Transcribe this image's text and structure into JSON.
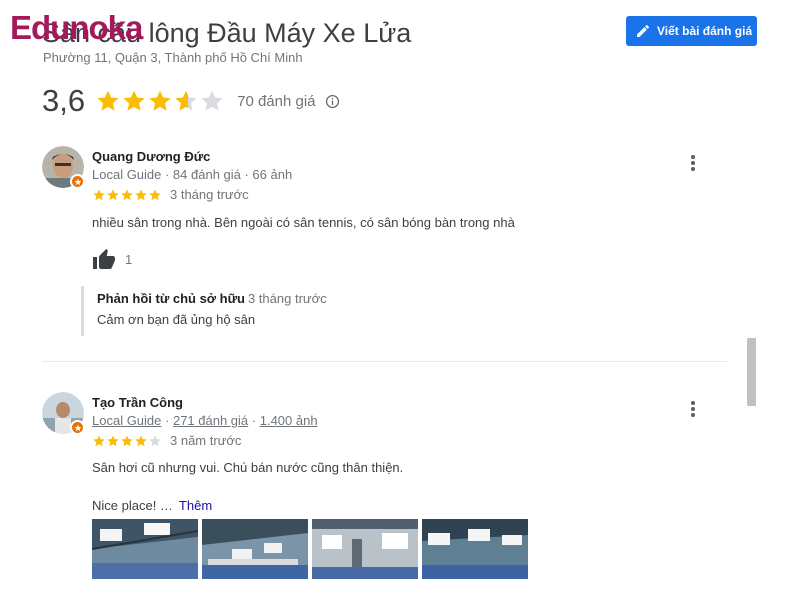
{
  "watermark": "Edunoka",
  "place": {
    "title": "Sân cầu lông Đầu Máy Xe Lửa",
    "address": "Phường 11, Quận 3, Thành phố Hồ Chí Minh",
    "rating": "3,6",
    "rating_stars": 3.6,
    "review_count": "70 đánh giá"
  },
  "toolbar": {
    "write_review_label": "Viết bài đánh giá"
  },
  "colors": {
    "accent": "#1a73e8",
    "star": "#fbbc04",
    "star_empty": "#dadce0",
    "badge": "#e8710a",
    "watermark": "#a3195b"
  },
  "reviews": [
    {
      "name": "Quang Dương Đức",
      "meta": "Local Guide · 84 đánh giá · 66 ảnh",
      "stars": 5,
      "time": "3 tháng trước",
      "text": "nhiều sân trong nhà. Bên ngoài có sân tennis, có sân bóng bàn trong nhà",
      "likes": "1",
      "owner_reply": {
        "title": "Phản hồi từ chủ sở hữu",
        "time": "3 tháng trước",
        "text": "Cảm ơn bạn đã ủng hộ sân"
      }
    },
    {
      "name": "Tạo Trần Công",
      "guide": "Local Guide",
      "reviews": "271 đánh giá",
      "photos": "1.400 ảnh",
      "stars": 4,
      "time": "3 năm trước",
      "text": "Sân hơi cũ nhưng vui. Chú bán nước cũng thân thiện.",
      "text2": "Nice place! …",
      "more_label": "Thêm"
    }
  ],
  "icons": [
    "pencil-icon",
    "info-icon",
    "more-vert-icon",
    "thumbs-up-icon",
    "local-guide-badge-icon"
  ]
}
